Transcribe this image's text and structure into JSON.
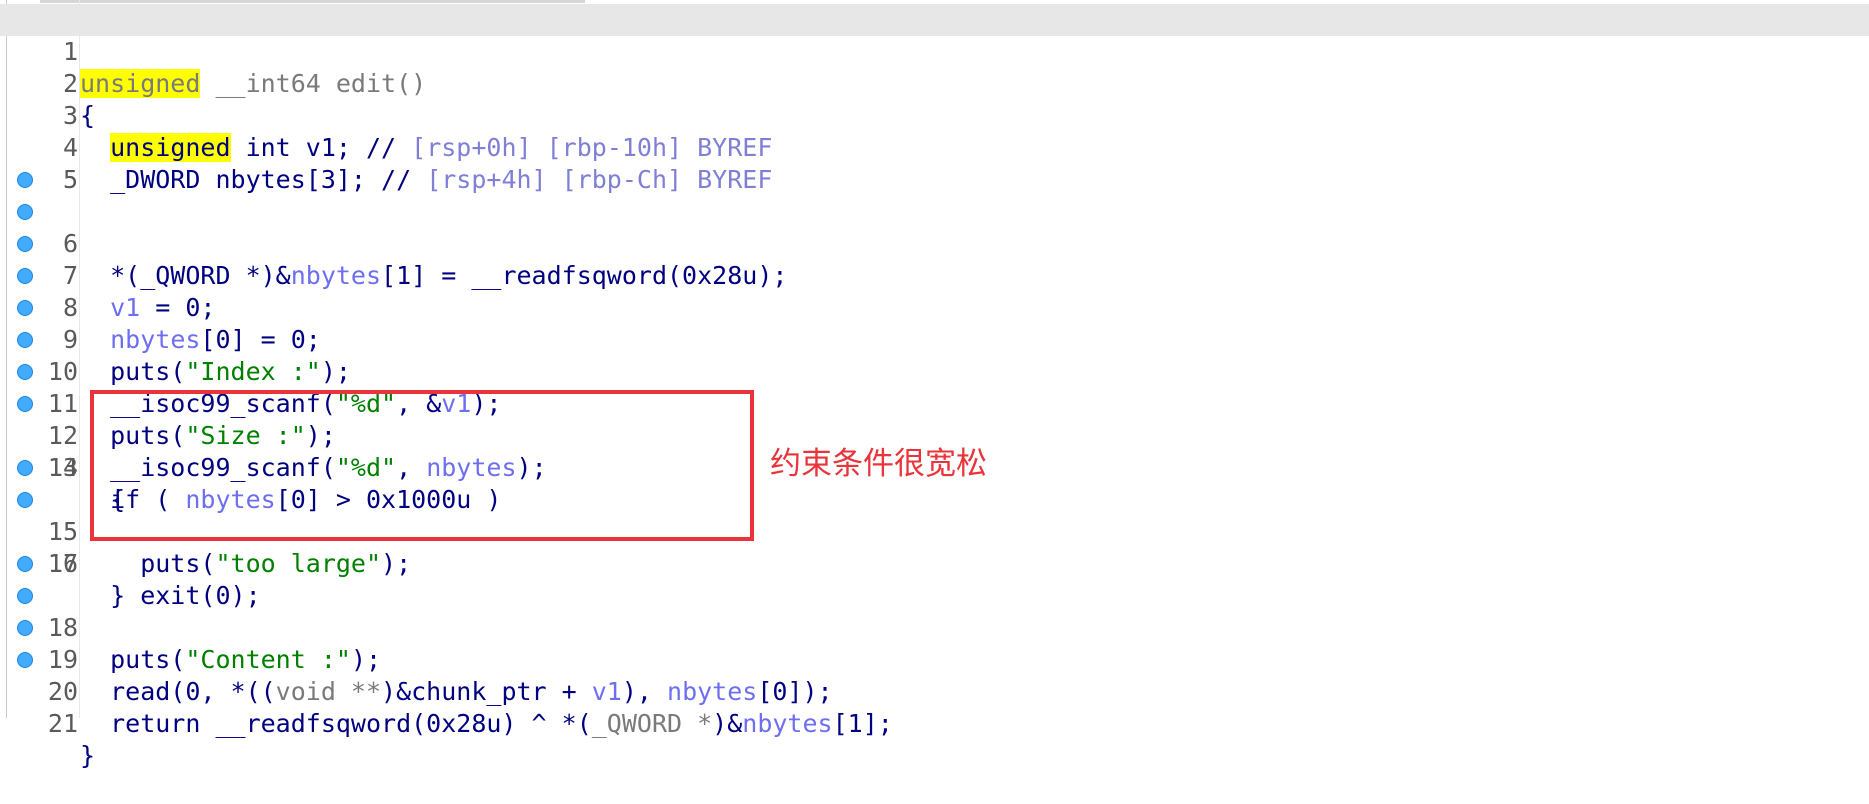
{
  "editor": {
    "lines": [
      {
        "num": "1",
        "bp": false,
        "t": [
          "unsigned",
          " __int64 edit()"
        ]
      },
      {
        "num": "2",
        "bp": false,
        "t": [
          "{"
        ]
      },
      {
        "num": "3",
        "bp": false,
        "t": [
          "  ",
          "unsigned",
          " int v1; // ",
          "[rsp+0h] [rbp-10h] BYREF"
        ]
      },
      {
        "num": "4",
        "bp": false,
        "t": [
          "  _DWORD nbytes[3]; // ",
          "[rsp+4h] [rbp-Ch] BYREF"
        ]
      },
      {
        "num": "5",
        "bp": false,
        "t": [
          ""
        ]
      },
      {
        "num": "6",
        "bp": true,
        "t": [
          "  *(_QWORD *)&",
          "nbytes",
          "[1] = __readfsqword(0x28u);"
        ]
      },
      {
        "num": "7",
        "bp": true,
        "t": [
          "  ",
          "v1",
          " = 0;"
        ]
      },
      {
        "num": "8",
        "bp": true,
        "t": [
          "  ",
          "nbytes",
          "[0] = 0;"
        ]
      },
      {
        "num": "9",
        "bp": true,
        "t": [
          "  puts(",
          "\"Index :\"",
          ");"
        ]
      },
      {
        "num": "10",
        "bp": true,
        "t": [
          "  __isoc99_scanf(",
          "\"%d\"",
          ", &",
          "v1",
          ");"
        ]
      },
      {
        "num": "11",
        "bp": true,
        "t": [
          "  puts(",
          "\"Size :\"",
          ");"
        ]
      },
      {
        "num": "12",
        "bp": true,
        "t": [
          "  __isoc99_scanf(",
          "\"%d\"",
          ", ",
          "nbytes",
          ");"
        ]
      },
      {
        "num": "13",
        "bp": true,
        "t": [
          "  if ( ",
          "nbytes",
          "[0] > 0x1000u )"
        ]
      },
      {
        "num": "14",
        "bp": false,
        "t": [
          "  {"
        ]
      },
      {
        "num": "15",
        "bp": true,
        "t": [
          "    puts(",
          "\"too large\"",
          ");"
        ]
      },
      {
        "num": "16",
        "bp": true,
        "t": [
          "    exit(0);"
        ]
      },
      {
        "num": "17",
        "bp": false,
        "t": [
          "  }"
        ]
      },
      {
        "num": "18",
        "bp": true,
        "t": [
          "  puts(",
          "\"Content :\"",
          ");"
        ]
      },
      {
        "num": "19",
        "bp": true,
        "t": [
          "  read(0, *((",
          "void **",
          ")&chunk_ptr + ",
          "v1",
          "), ",
          "nbytes",
          "[0]);"
        ]
      },
      {
        "num": "20",
        "bp": true,
        "t": [
          "  return __readfsqword(0x28u) ^ *(",
          "_QWORD *",
          ")&",
          "nbytes",
          "[1];"
        ]
      },
      {
        "num": "21",
        "bp": true,
        "t": [
          "}"
        ]
      }
    ]
  },
  "annotation": {
    "text": "约束条件很宽松",
    "color": "#e8343a"
  },
  "colors": {
    "keyword": "#000080",
    "string": "#008000",
    "variable": "#6e6ef0",
    "highlight": "#ffff00",
    "breakpoint": "#44aaff"
  }
}
